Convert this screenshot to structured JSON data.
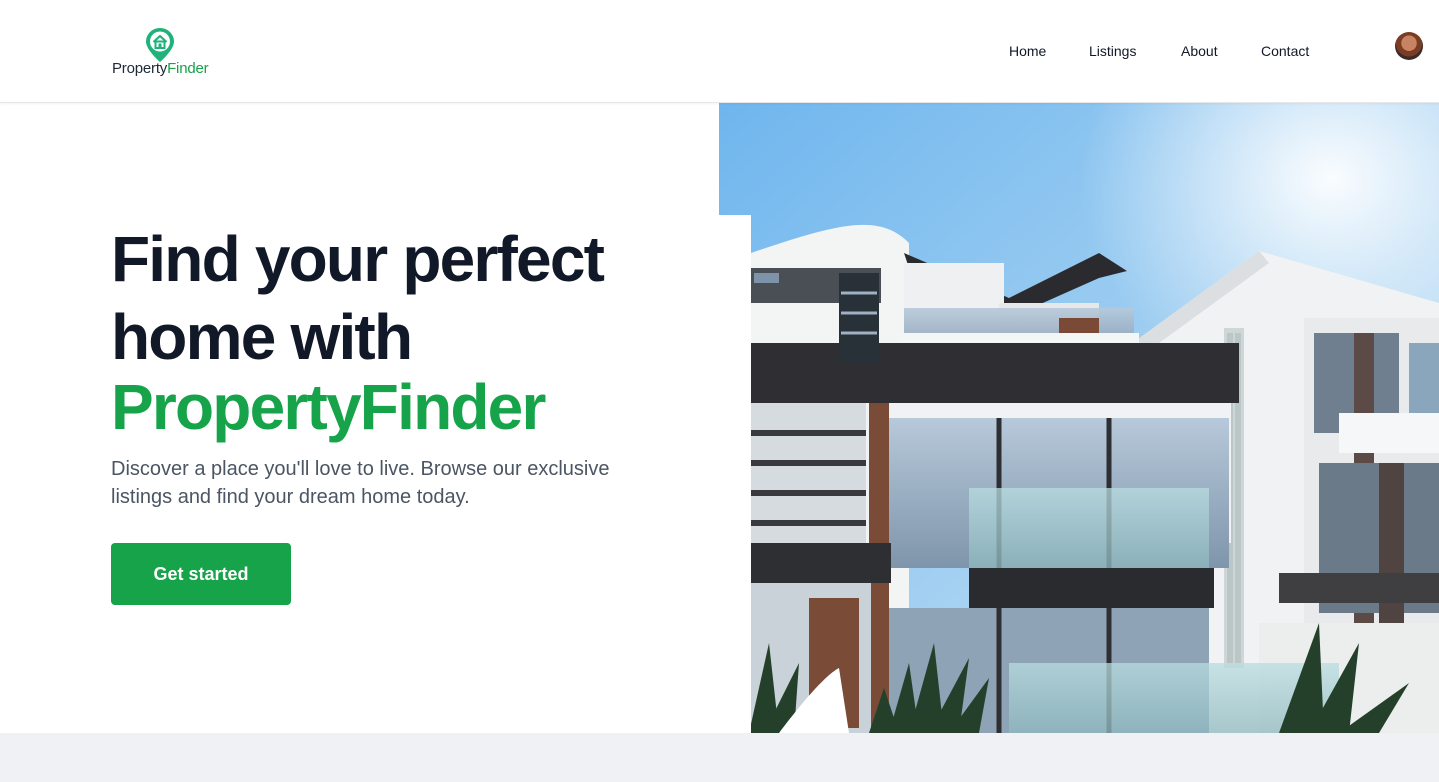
{
  "brand": {
    "name_part1": "Property",
    "name_part2": "Finder",
    "accent_color": "#16a34a",
    "icon": "house-pin-icon"
  },
  "nav": {
    "items": [
      {
        "label": "Home"
      },
      {
        "label": "Listings"
      },
      {
        "label": "About"
      },
      {
        "label": "Contact"
      }
    ]
  },
  "user": {
    "avatar": "user-avatar"
  },
  "hero": {
    "title_line1": "Find your perfect",
    "title_line2": "home with",
    "title_accent": "PropertyFinder",
    "subtitle": "Discover a place you'll love to live. Browse our exclusive listings and find your dream home today.",
    "cta_label": "Get started",
    "image": "modern-apartment-building-photo"
  },
  "colors": {
    "heading": "#111827",
    "body_text": "#4b5563",
    "footer_band": "#f0f1f5"
  }
}
